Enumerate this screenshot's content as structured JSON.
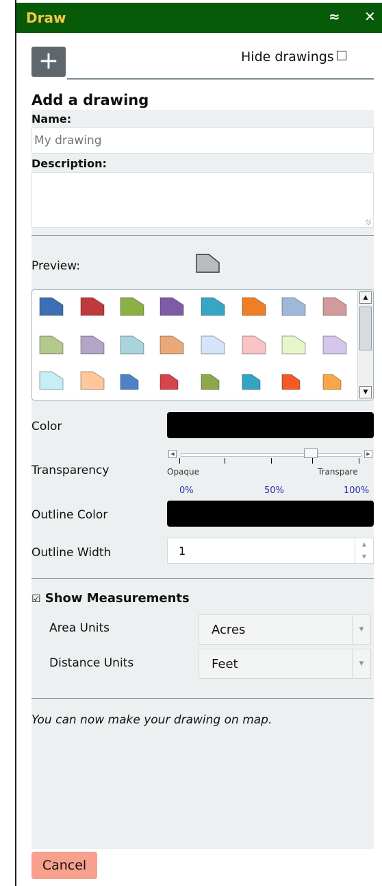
{
  "window": {
    "title": "Draw",
    "collapse_icon": "double-chevron-up-icon",
    "close_icon": "close-icon",
    "collapse_glyph": "≈",
    "close_glyph": "✕"
  },
  "toolbar": {
    "add_icon": "plus-icon",
    "add_glyph": "+",
    "hide_label": "Hide drawings"
  },
  "form": {
    "heading": "Add a drawing",
    "name_label": "Name:",
    "name_placeholder": "My drawing",
    "description_label": "Description:",
    "preview_label": "Preview:",
    "color_label": "Color",
    "transparency_label": "Transparency",
    "transparency_left": "Opaque",
    "transparency_right": "Transpare",
    "transparency_marks": [
      "0%",
      "50%",
      "100%"
    ],
    "outline_color_label": "Outline Color",
    "outline_width_label": "Outline Width",
    "outline_width_value": "1",
    "show_measurements_label": "Show Measurements",
    "show_measurements_checked": "☑",
    "area_units_label": "Area Units",
    "area_units_value": "Acres",
    "distance_units_label": "Distance Units",
    "distance_units_value": "Feet",
    "note": "You can now make your drawing on map.",
    "cancel_label": "Cancel"
  },
  "colors": {
    "fill": "#000000",
    "outline": "#000000",
    "preview_fill": "#b8bcbe",
    "swatches": [
      "#3d6fb6",
      "#c0393c",
      "#8cb044",
      "#7d5ba6",
      "#37a6c4",
      "#ef7e25",
      "#9eb8d8",
      "#d39a9c",
      "#b3c98e",
      "#b4a5c8",
      "#a9d3dd",
      "#eaa978",
      "#d5e4fa",
      "#f9c4c5",
      "#e7f5cb",
      "#d5c7ec",
      "#c6eef8",
      "#ffc79a",
      "#4f81c7",
      "#d5454c",
      "#8ca84a",
      "#33a5c2",
      "#f45a25",
      "#fba54a"
    ]
  }
}
